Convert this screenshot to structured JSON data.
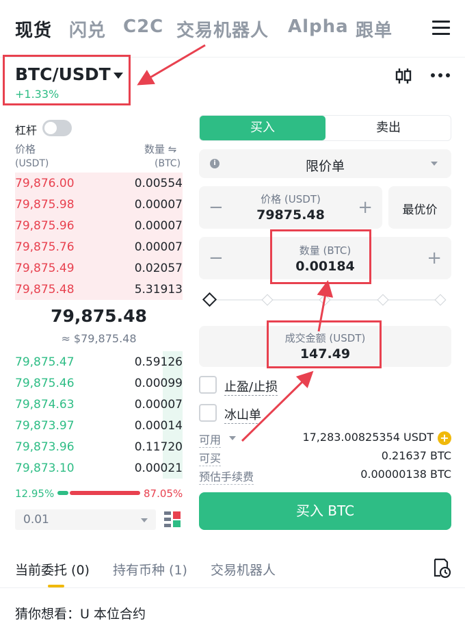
{
  "nav": {
    "tabs": [
      "现货",
      "闪兑",
      "C2C",
      "交易机器人",
      "Alpha",
      "跟单"
    ],
    "active_index": 0
  },
  "pair": {
    "name": "BTC/USDT",
    "change": "+1.33%"
  },
  "orderbook": {
    "leverage_label": "杠杆",
    "price_header": "价格",
    "price_unit": "(USDT)",
    "qty_header": "数量 ⇋",
    "qty_unit": "(BTC)",
    "asks": [
      {
        "price": "79,876.00",
        "qty": "0.00554",
        "depth": 1.0
      },
      {
        "price": "79,875.98",
        "qty": "0.00007",
        "depth": 1.0
      },
      {
        "price": "79,875.96",
        "qty": "0.00007",
        "depth": 1.0
      },
      {
        "price": "79,875.76",
        "qty": "0.00007",
        "depth": 1.0
      },
      {
        "price": "79,875.49",
        "qty": "0.02057",
        "depth": 1.0
      },
      {
        "price": "79,875.48",
        "qty": "5.31913",
        "depth": 1.0
      }
    ],
    "last_price": "79,875.48",
    "last_price_fiat": "≈ $79,875.48",
    "bids": [
      {
        "price": "79,875.47",
        "qty": "0.59126",
        "depth": 0.12
      },
      {
        "price": "79,875.46",
        "qty": "0.00099",
        "depth": 0.12
      },
      {
        "price": "79,874.63",
        "qty": "0.00007",
        "depth": 0.12
      },
      {
        "price": "79,873.97",
        "qty": "0.00014",
        "depth": 0.12
      },
      {
        "price": "79,873.96",
        "qty": "0.11720",
        "depth": 0.12
      },
      {
        "price": "79,873.10",
        "qty": "0.00021",
        "depth": 0.12
      }
    ],
    "bid_ratio": "12.95%",
    "ask_ratio": "87.05%",
    "precision": "0.01"
  },
  "form": {
    "buy_tab": "买入",
    "sell_tab": "卖出",
    "order_type": "限价单",
    "price_label": "价格 (USDT)",
    "price_value": "79875.48",
    "best_price": "最优价",
    "qty_label": "数量 (BTC)",
    "qty_value": "0.00184",
    "total_label": "成交金额 (USDT)",
    "total_value": "147.49",
    "tpsl_label": "止盈/止损",
    "iceberg_label": "冰山单",
    "available_label": "可用",
    "available_value": "17,283.00825354 USDT",
    "can_buy_label": "可买",
    "can_buy_value": "0.21637 BTC",
    "fee_label": "预估手续费",
    "fee_value": "0.00000138 BTC",
    "submit": "买入 BTC",
    "minus": "−",
    "plus": "+"
  },
  "bottom": {
    "tabs": [
      "当前委托 (0)",
      "持有币种 (1)",
      "交易机器人"
    ],
    "suggest": "猜你想看：U 本位合约"
  },
  "colors": {
    "buy_green": "#2ebd85",
    "sell_red": "#e8414f",
    "accent_yellow": "#f0b90b",
    "annotation_red": "#e8414f"
  }
}
